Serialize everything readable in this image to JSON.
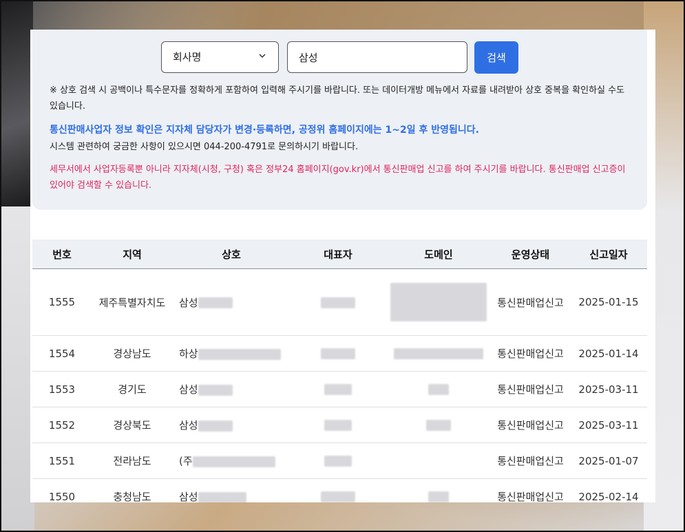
{
  "search": {
    "select_value": "회사명",
    "input_value": "삼성",
    "button_label": "검색"
  },
  "notices": {
    "note1": "※ 상호 검색 시 공백이나 특수문자를 정확하게 포함하여 입력해 주시기를 바랍니다. 또는 데이터개방 메뉴에서 자료를 내려받아 상호 중복을 확인하실 수도 있습니다.",
    "note2": "통신판매사업자 정보 확인은 지자체 담당자가 변경·등록하면, 공정위 홈페이지에는 1~2일 후 반영됩니다.",
    "note3": "시스템 관련하여 궁금한 사항이 있으시면 044-200-4791로 문의하시기 바랍니다.",
    "note4": "세무서에서 사업자등록뿐 아니라 지자체(시청, 구청) 혹은 정부24 홈페이지(gov.kr)에서 통신판매업 신고를 하여 주시기를 바랍니다. 통신판매업 신고증이 있어야 검색할 수 있습니다."
  },
  "table": {
    "headers": [
      "번호",
      "지역",
      "상호",
      "대표자",
      "도메인",
      "운영상태",
      "신고일자"
    ],
    "rows": [
      {
        "no": "1555",
        "region": "제주특별자치도",
        "name": "삼성",
        "status": "통신판매업신고",
        "date": "2025-01-15"
      },
      {
        "no": "1554",
        "region": "경상남도",
        "name": "하상",
        "status": "통신판매업신고",
        "date": "2025-01-14"
      },
      {
        "no": "1553",
        "region": "경기도",
        "name": "삼성",
        "status": "통신판매업신고",
        "date": "2025-03-11"
      },
      {
        "no": "1552",
        "region": "경상북도",
        "name": "삼성",
        "status": "통신판매업신고",
        "date": "2025-03-11"
      },
      {
        "no": "1551",
        "region": "전라남도",
        "name": "(주",
        "status": "통신판매업신고",
        "date": "2025-01-07"
      },
      {
        "no": "1550",
        "region": "충청남도",
        "name": "삼성",
        "status": "통신판매업신고",
        "date": "2025-02-14"
      }
    ]
  }
}
